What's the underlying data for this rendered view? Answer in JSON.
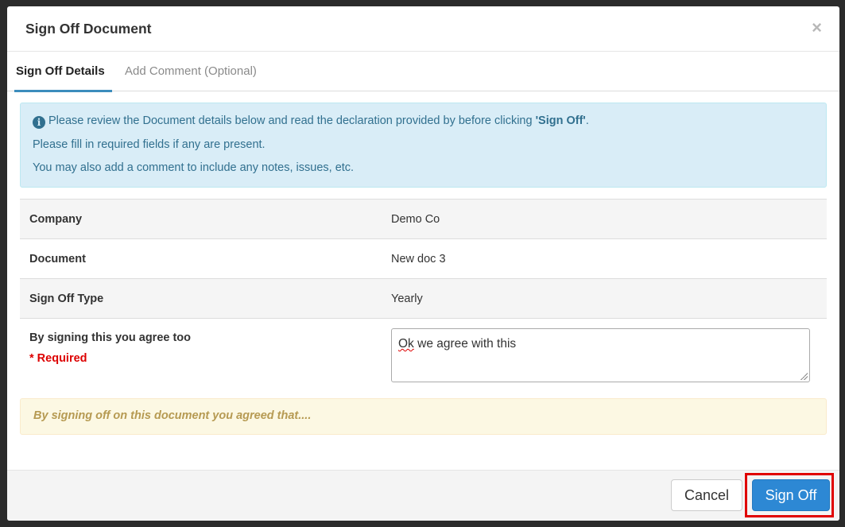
{
  "modal": {
    "title": "Sign Off Document",
    "close_glyph": "×"
  },
  "tabs": [
    {
      "label": "Sign Off Details",
      "active": true
    },
    {
      "label": "Add Comment (Optional)",
      "active": false
    }
  ],
  "info_alert": {
    "icon": "info-icon",
    "line1_prefix": "Please review the Document details below and read the declaration provided by before clicking ",
    "line1_emphasis": "'Sign Off'",
    "line1_suffix": ".",
    "line2": "Please fill in required fields if any are present.",
    "line3": "You may also add a comment to include any notes, issues, etc."
  },
  "details": [
    {
      "label": "Company",
      "value": "Demo Co"
    },
    {
      "label": "Document",
      "value": "New doc 3"
    },
    {
      "label": "Sign Off Type",
      "value": "Yearly"
    }
  ],
  "agreement": {
    "label": "By signing this you agree too",
    "required_text": "* Required",
    "value_first_word": "Ok",
    "value_rest": " we agree with this"
  },
  "warning_alert": {
    "text": "By signing off on this document you agreed that...."
  },
  "footer": {
    "cancel_label": "Cancel",
    "signoff_label": "Sign Off"
  },
  "colors": {
    "highlight": "#e00000",
    "primary": "#2d88d4",
    "info_bg": "#d9edf7",
    "warning_bg": "#fcf8e3",
    "required": "#dd0000"
  }
}
